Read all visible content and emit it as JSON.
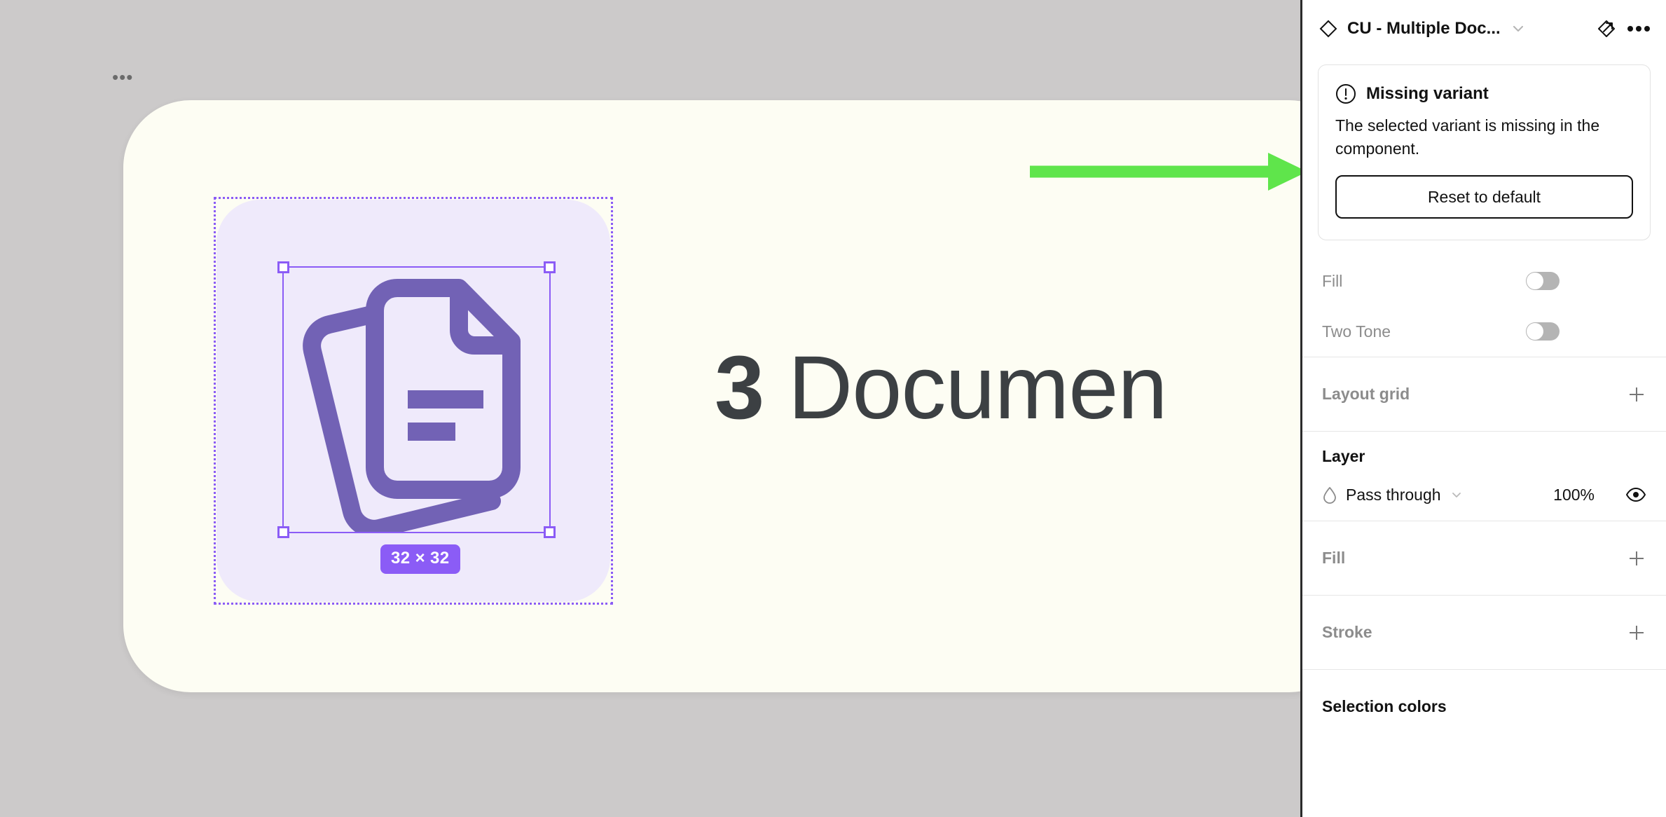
{
  "canvas": {
    "more_dots": "•••",
    "artwork": {
      "size_badge": "32 × 32",
      "label_number": "3",
      "label_word": " Documen",
      "icon_name": "multiple-documents-icon",
      "icon_stroke_color": "#7262b5",
      "icon_tile_color": "#efeafb",
      "card_color": "#fdfdf3",
      "card_border_color": "#eceadf",
      "selection_color": "#8b5cf6"
    },
    "annotation": {
      "type": "arrow",
      "direction": "right",
      "color": "#5fe54b"
    },
    "background_color": "#cccaca"
  },
  "panel": {
    "header": {
      "component_icon": "diamond-icon",
      "title": "CU - Multiple Doc...",
      "dropdown_icon": "chevron-down-icon",
      "publish_icon": "share-publish-icon",
      "more_icon": "more-options-icon"
    },
    "warning": {
      "icon": "exclamation-circle-icon",
      "title": "Missing variant",
      "message": "The selected variant is missing in the component.",
      "button_label": "Reset to default"
    },
    "properties": [
      {
        "label": "Fill",
        "control": "toggle",
        "value": "off"
      },
      {
        "label": "Two Tone",
        "control": "toggle",
        "value": "off"
      }
    ],
    "sections": [
      {
        "label": "Layout grid",
        "style": "muted",
        "action_icon": "plus-icon"
      },
      {
        "label": "Fill",
        "style": "muted",
        "action_icon": "plus-icon"
      },
      {
        "label": "Stroke",
        "style": "muted",
        "action_icon": "plus-icon"
      },
      {
        "label": "Selection colors",
        "style": "dark",
        "action_icon": "none"
      }
    ],
    "layer": {
      "heading": "Layer",
      "blend_icon": "droplet-icon",
      "blend_mode": "Pass through",
      "blend_chevron": "chevron-down-icon",
      "opacity": "100%",
      "visibility_icon": "eye-icon"
    }
  }
}
